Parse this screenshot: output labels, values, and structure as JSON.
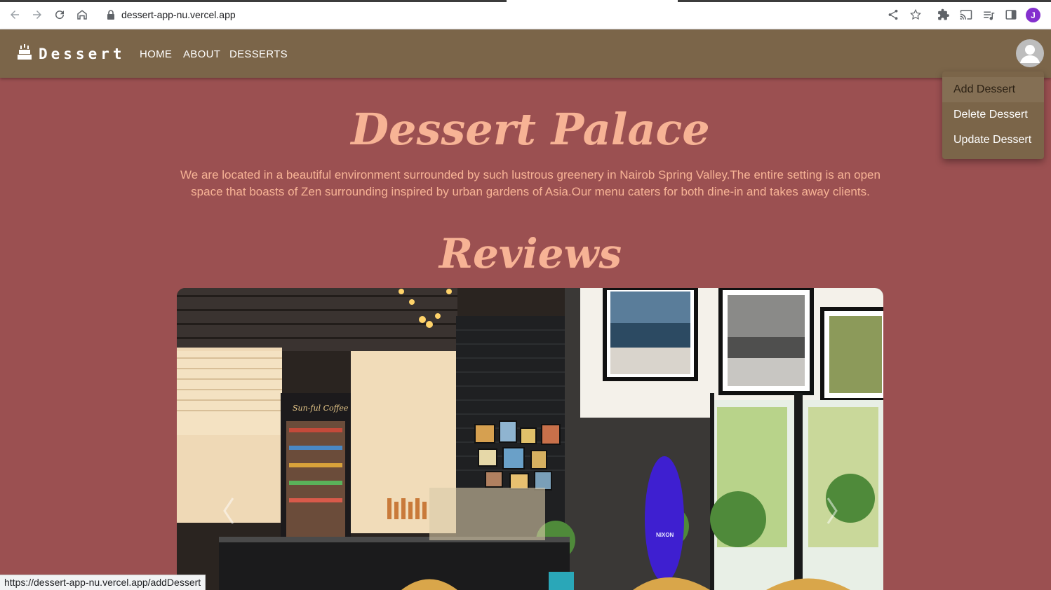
{
  "browser": {
    "url": "dessert-app-nu.vercel.app",
    "profile_initial": "J",
    "status_url": "https://dessert-app-nu.vercel.app/addDessert"
  },
  "navbar": {
    "brand": "Dessert",
    "links": [
      "HOME",
      "ABOUT",
      "DESSERTS"
    ]
  },
  "menu": {
    "items": [
      "Add Dessert",
      "Delete Dessert",
      "Update Dessert"
    ],
    "highlighted": "Add Dessert"
  },
  "hero": {
    "title": "Dessert Palace",
    "description": "We are located in a beautiful environment surrounded by such lustrous greenery in Nairob Spring Valley.The entire setting is an open space that boasts of Zen surrounding inspired by urban gardens of Asia.Our menu caters for both dine-in and takes away clients."
  },
  "reviews": {
    "title": "Reviews",
    "image_alt": "cafe interior photo",
    "photo_texts": {
      "fridge_sign": "Sun-ful Coffee",
      "surfboard": "NIXON"
    }
  },
  "colors": {
    "page_bg": "#9b5051",
    "navbar_bg": "#7b6549",
    "accent_text": "#f7b395"
  }
}
